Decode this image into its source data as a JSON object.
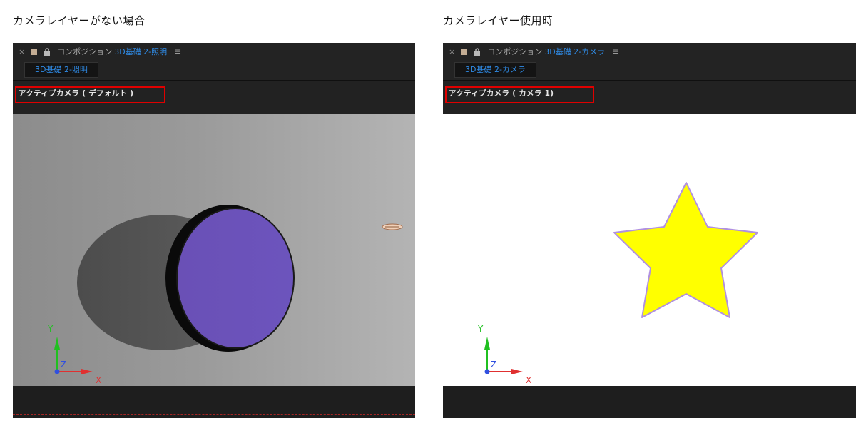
{
  "left": {
    "heading": "カメラレイヤーがない場合",
    "titlebar": {
      "close": "×",
      "comp_label": "コンポジション",
      "comp_name": "3D基礎 2-照明",
      "menu": "≡"
    },
    "tab_label": "3D基礎 2-照明",
    "camera_label": "アクティブカメラ ( デフォルト )",
    "axes": {
      "x": "X",
      "y": "Y",
      "z": "Z"
    },
    "colors": {
      "disc_face": "#6a51b8",
      "shadow": "#5a5a5a",
      "x_axis": "#e03030",
      "y_axis": "#20c020",
      "z_axis": "#3050e0"
    }
  },
  "right": {
    "heading": "カメラレイヤー使用時",
    "titlebar": {
      "close": "×",
      "comp_label": "コンポジション",
      "comp_name": "3D基礎 2-カメラ",
      "menu": "≡"
    },
    "tab_label": "3D基礎 2-カメラ",
    "camera_label": "アクティブカメラ ( カメラ 1)",
    "axes": {
      "x": "X",
      "y": "Y",
      "z": "Z"
    },
    "colors": {
      "star_fill": "#ffff00",
      "star_stroke": "#b090e0",
      "x_axis": "#e03030",
      "y_axis": "#20c020",
      "z_axis": "#3050e0"
    }
  }
}
